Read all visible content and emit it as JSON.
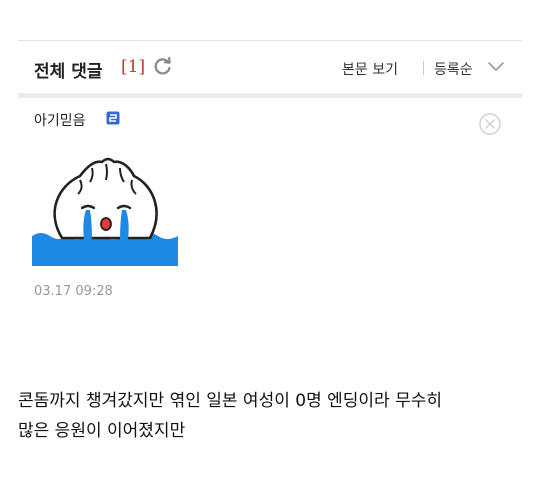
{
  "comments_header": {
    "title": "전체 댓글",
    "count": "[1]",
    "view_body_label": "본문 보기",
    "sort_label": "등록순"
  },
  "comment": {
    "author": "아기믿음",
    "date": "03.17 09:28",
    "sticker_icon": "crying-dumpling-sticker"
  },
  "article": {
    "lines": [
      "콘돔까지 챙겨갔지만 엮인 일본 여성이 0명 엔딩이라 무수히",
      "많은 응원이 이어졌지만"
    ]
  },
  "colors": {
    "count_red": "#c0392b",
    "sticker_water": "#1e88e5",
    "badge_blue": "#2e6bd6"
  }
}
